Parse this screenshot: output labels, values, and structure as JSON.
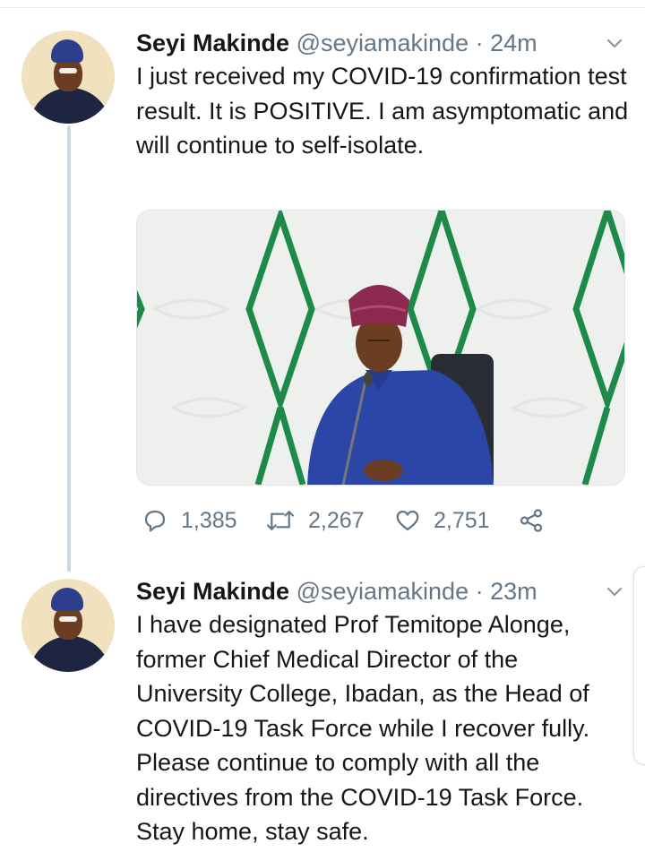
{
  "tweets": [
    {
      "author_name": "Seyi Makinde",
      "author_handle": "@seyiamakinde",
      "separator": "·",
      "time": "24m",
      "text": "I just received my COVID-19 confirmation test result. It is POSITIVE. I am asymptomatic and will continue to self-isolate.",
      "stats": {
        "replies": "1,385",
        "retweets": "2,267",
        "likes": "2,751"
      }
    },
    {
      "author_name": "Seyi Makinde",
      "author_handle": "@seyiamakinde",
      "separator": "·",
      "time": "23m",
      "text": "I have designated Prof Temitope Alonge, former Chief Medical Director of the University College, Ibadan, as the Head of COVID-19 Task Force while I recover fully. Please continue to comply with all the directives from the COVID-19 Task Force. Stay home, stay safe."
    }
  ],
  "colors": {
    "text": "#14171a",
    "secondary": "#657786",
    "thread_line": "#ccd6dd",
    "photo_wall": "#eef0ee",
    "photo_green": "#1e8a4a",
    "agbada_blue": "#2c46a8"
  },
  "icons": [
    "avatar",
    "chevron-down-icon",
    "reply-icon",
    "retweet-icon",
    "like-icon",
    "share-icon"
  ]
}
